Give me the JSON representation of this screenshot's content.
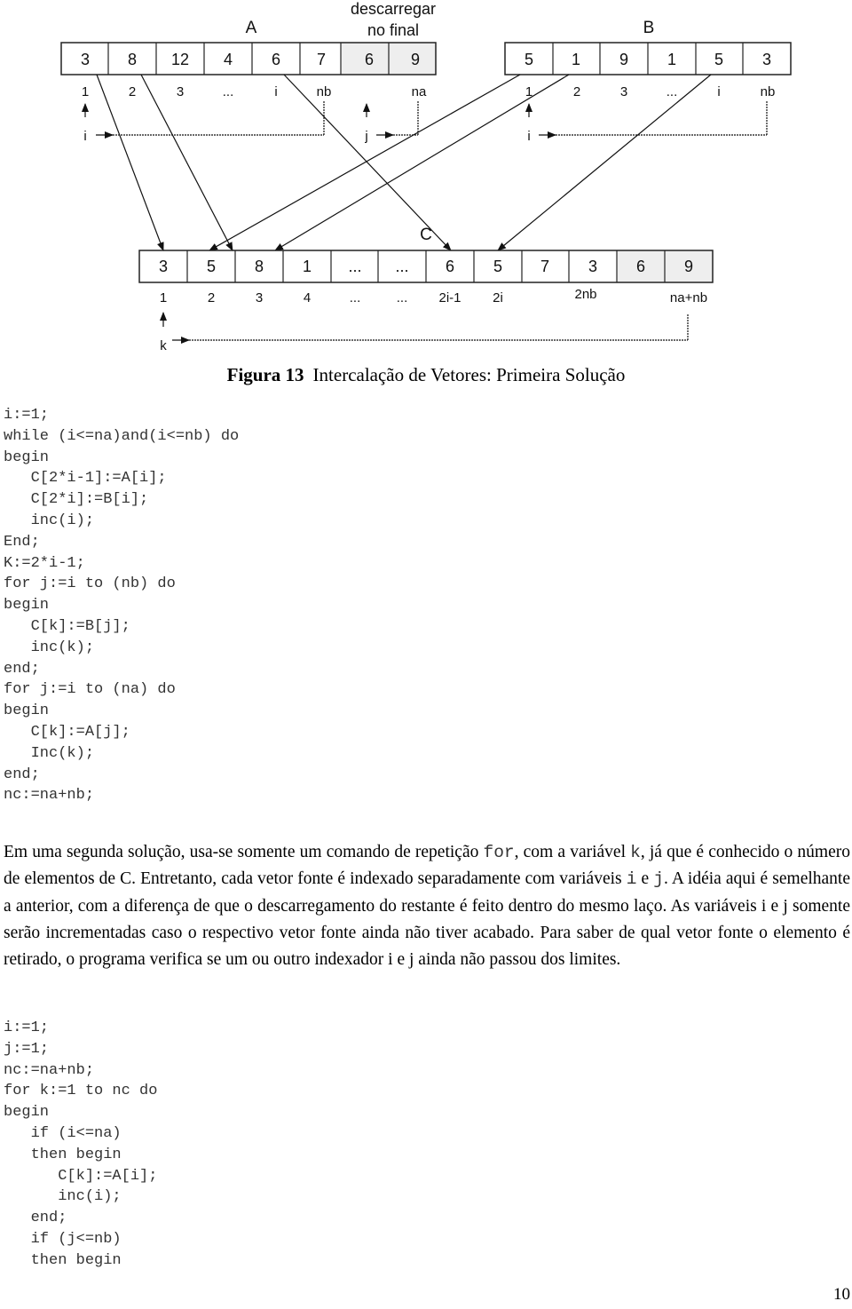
{
  "figure": {
    "vector_a": {
      "label": "A",
      "cells": [
        "3",
        "8",
        "12",
        "4",
        "6",
        "7",
        "6",
        "9"
      ],
      "highlighted_cells": [
        6,
        7
      ],
      "indices": [
        "1",
        "2",
        "3",
        "...",
        "i",
        "nb",
        "na"
      ],
      "pointer": "i",
      "pointer2": "j"
    },
    "vector_b": {
      "label": "B",
      "cells": [
        "5",
        "1",
        "9",
        "1",
        "5",
        "3"
      ],
      "indices": [
        "1",
        "2",
        "3",
        "...",
        "i",
        "nb"
      ],
      "pointer": "i"
    },
    "vector_c": {
      "label": "C",
      "cells": [
        "3",
        "5",
        "8",
        "1",
        "...",
        "...",
        "6",
        "5",
        "7",
        "3",
        "6",
        "9"
      ],
      "highlighted_cells": [
        10,
        11
      ],
      "indices": [
        "1",
        "2",
        "3",
        "4",
        "...",
        "...",
        "2i-1",
        "2i",
        "2nb",
        "na+nb"
      ],
      "pointer": "k"
    },
    "annotation_line1": "descarregar",
    "annotation_line2": "no final",
    "caption_number": "Figura 13",
    "caption_text": "Intercalação de Vetores: Primeira Solução"
  },
  "code_block_1": "i:=1;\nwhile (i<=na)and(i<=nb) do\nbegin\n   C[2*i-1]:=A[i];\n   C[2*i]:=B[i];\n   inc(i);\nEnd;\nK:=2*i-1;\nfor j:=i to (nb) do\nbegin\n   C[k]:=B[j];\n   inc(k);\nend;\nfor j:=i to (na) do\nbegin\n   C[k]:=A[j];\n   Inc(k);\nend;\nnc:=na+nb;",
  "paragraph": {
    "p1": "Em uma segunda solução, usa-se somente um comando de repetição ",
    "c1": "for",
    "p2": ", com a variável ",
    "c2": "k",
    "p3": ", já que é conhecido o número de elementos de C. Entretanto, cada vetor fonte é indexado separadamente com variáveis ",
    "c3": "i",
    "p4": " e ",
    "c4": "j",
    "p5": ". A idéia aqui é semelhante a anterior, com a diferença de que o descarregamento do restante é feito dentro do mesmo laço. As variáveis i e j somente serão incrementadas caso o respectivo vetor fonte ainda não tiver acabado. Para saber de qual vetor fonte o elemento é retirado, o programa verifica se um ou outro indexador i e j ainda não passou dos limites."
  },
  "code_block_2": "i:=1;\nj:=1;\nnc:=na+nb;\nfor k:=1 to nc do\nbegin\n   if (i<=na)\n   then begin\n      C[k]:=A[i];\n      inc(i);\n   end;\n   if (j<=nb)\n   then begin",
  "page_number": "10"
}
